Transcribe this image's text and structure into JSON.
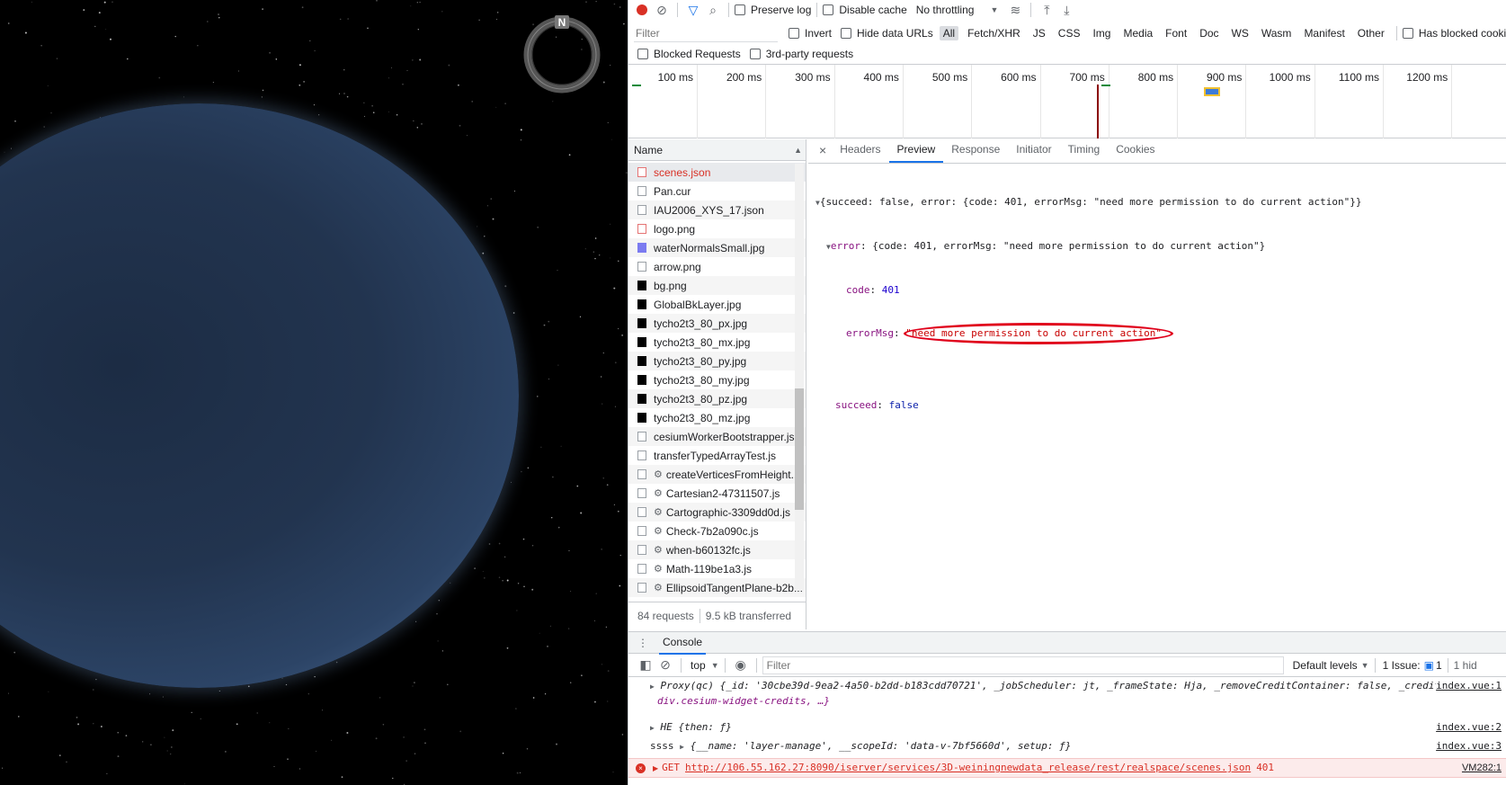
{
  "compass_letter": "N",
  "toolbar": {
    "preserve_log": "Preserve log",
    "disable_cache": "Disable cache",
    "throttling": "No throttling"
  },
  "filter": {
    "placeholder": "Filter",
    "invert": "Invert",
    "hide_data_urls": "Hide data URLs",
    "types": [
      "All",
      "Fetch/XHR",
      "JS",
      "CSS",
      "Img",
      "Media",
      "Font",
      "Doc",
      "WS",
      "Wasm",
      "Manifest",
      "Other"
    ],
    "has_blocked_cookies": "Has blocked cookies",
    "blocked_requests": "Blocked Requests",
    "third_party": "3rd-party requests"
  },
  "timeline": {
    "ticks": [
      "100 ms",
      "200 ms",
      "300 ms",
      "400 ms",
      "500 ms",
      "600 ms",
      "700 ms",
      "800 ms",
      "900 ms",
      "1000 ms",
      "1100 ms",
      "1200 ms"
    ]
  },
  "requests": {
    "header": "Name",
    "items": [
      {
        "name": "scenes.json",
        "icon": "red",
        "error": true
      },
      {
        "name": "Pan.cur",
        "icon": "file"
      },
      {
        "name": "IAU2006_XYS_17.json",
        "icon": "file"
      },
      {
        "name": "logo.png",
        "icon": "red"
      },
      {
        "name": "waterNormalsSmall.jpg",
        "icon": "blue"
      },
      {
        "name": "arrow.png",
        "icon": "file"
      },
      {
        "name": "bg.png",
        "icon": "black"
      },
      {
        "name": "GlobalBkLayer.jpg",
        "icon": "black"
      },
      {
        "name": "tycho2t3_80_px.jpg",
        "icon": "black"
      },
      {
        "name": "tycho2t3_80_mx.jpg",
        "icon": "black"
      },
      {
        "name": "tycho2t3_80_py.jpg",
        "icon": "black"
      },
      {
        "name": "tycho2t3_80_my.jpg",
        "icon": "black"
      },
      {
        "name": "tycho2t3_80_pz.jpg",
        "icon": "black"
      },
      {
        "name": "tycho2t3_80_mz.jpg",
        "icon": "black"
      },
      {
        "name": "cesiumWorkerBootstrapper.js",
        "icon": "file"
      },
      {
        "name": "transferTypedArrayTest.js",
        "icon": "file"
      },
      {
        "name": "createVerticesFromHeight...",
        "icon": "file",
        "gear": true
      },
      {
        "name": "Cartesian2-47311507.js",
        "icon": "file",
        "gear": true
      },
      {
        "name": "Cartographic-3309dd0d.js",
        "icon": "file",
        "gear": true
      },
      {
        "name": "Check-7b2a090c.js",
        "icon": "file",
        "gear": true
      },
      {
        "name": "when-b60132fc.js",
        "icon": "file",
        "gear": true
      },
      {
        "name": "Math-119be1a3.js",
        "icon": "file",
        "gear": true
      },
      {
        "name": "EllipsoidTangentPlane-b2b...",
        "icon": "file",
        "gear": true
      }
    ],
    "summary_count": "84 requests",
    "summary_transferred": "9.5 kB transferred"
  },
  "detail": {
    "tabs": [
      "Headers",
      "Preview",
      "Response",
      "Initiator",
      "Timing",
      "Cookies"
    ],
    "active_tab": "Preview",
    "preview": {
      "root_line": "{succeed: false, error: {code: 401, errorMsg: \"need more permission to do current action\"}}",
      "error_key": "error",
      "error_line": "{code: 401, errorMsg: \"need more permission to do current action\"}",
      "code_key": "code",
      "code_value": "401",
      "errormsg_key": "errorMsg",
      "errormsg_value": "\"need more permission to do current action\"",
      "succeed_key": "succeed",
      "succeed_value": "false"
    }
  },
  "console": {
    "tab": "Console",
    "context": "top",
    "filter_placeholder": "Filter",
    "levels": "Default levels",
    "issues": "1 Issue:",
    "issues_count": "1",
    "hidden": "1 hid",
    "lines": [
      {
        "prefix": "",
        "text": "Proxy(qc) {_id: '30cbe39d-9ea2-4a50-b2dd-b183cdd70721', _jobScheduler: jt, _frameState: Hja, _removeCreditContainer: false, _creditContainer:",
        "text2": "div.cesium-widget-credits, …}",
        "src": "index.vue:1"
      },
      {
        "prefix": "",
        "text": "HE {then: ƒ}",
        "src": "index.vue:2"
      },
      {
        "prefix": "ssss",
        "text": "{__name: 'layer-manage', __scopeId: 'data-v-7bf5660d', setup: ƒ}",
        "src": "index.vue:3"
      }
    ],
    "error": {
      "method": "GET",
      "url": "http://106.55.162.27:8090/iserver/services/3D-weiningnewdata_release/rest/realspace/scenes.json",
      "status": "401",
      "src": "VM282:1"
    }
  },
  "colors": {
    "accent": "#1a73e8",
    "error_red": "#d93025",
    "highlight_oval": "#e0001b"
  }
}
